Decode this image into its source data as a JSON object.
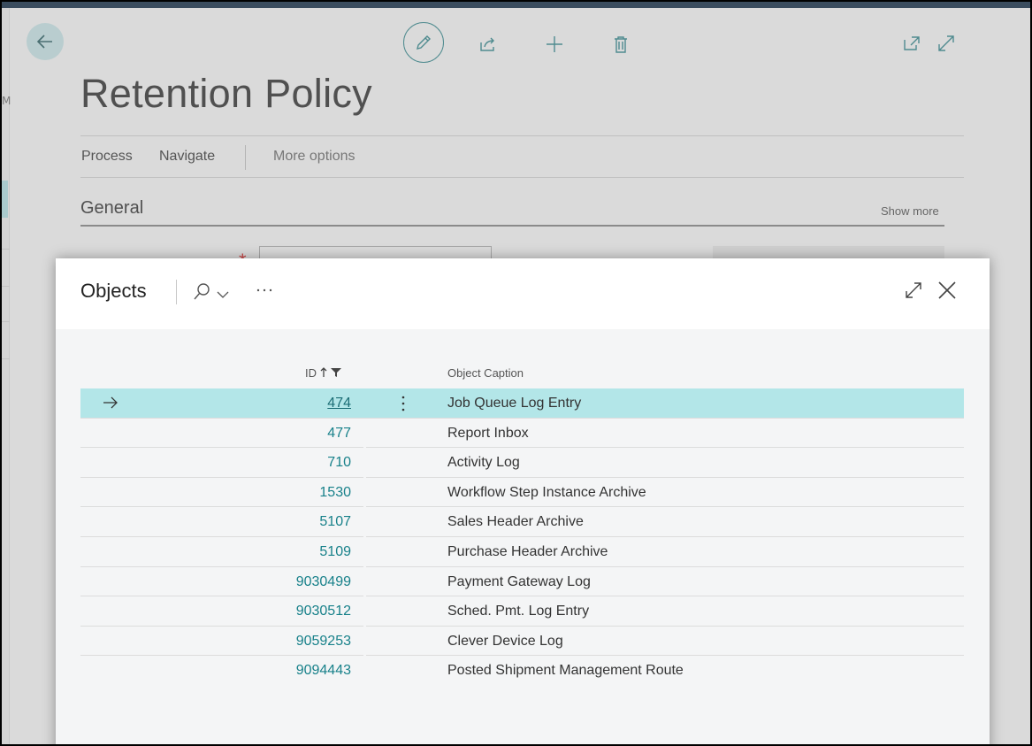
{
  "page": {
    "title": "Retention Policy",
    "menu": [
      "Process",
      "Navigate",
      "More options"
    ],
    "section": {
      "title": "General",
      "show_more": "Show more"
    }
  },
  "icons": {
    "back": "back-arrow-icon",
    "edit": "pencil-icon",
    "share": "share-icon",
    "new": "plus-icon",
    "delete": "trash-icon",
    "open_new_window": "open-in-new-window-icon",
    "expand": "expand-icon"
  },
  "dialog": {
    "title": "Objects",
    "columns": {
      "id": "ID",
      "caption": "Object Caption"
    },
    "rows": [
      {
        "id": "474",
        "caption": "Job Queue Log Entry"
      },
      {
        "id": "477",
        "caption": "Report Inbox"
      },
      {
        "id": "710",
        "caption": "Activity Log"
      },
      {
        "id": "1530",
        "caption": "Workflow Step Instance Archive"
      },
      {
        "id": "5107",
        "caption": "Sales Header Archive"
      },
      {
        "id": "5109",
        "caption": "Purchase Header Archive"
      },
      {
        "id": "9030499",
        "caption": "Payment Gateway Log"
      },
      {
        "id": "9030512",
        "caption": "Sched. Pmt. Log Entry"
      },
      {
        "id": "9059253",
        "caption": "Clever Device Log"
      },
      {
        "id": "9094443",
        "caption": "Posted Shipment Management Route"
      }
    ],
    "selected_index": 0
  },
  "colors": {
    "accent": "#18818a",
    "selected_row": "#b3e6e8",
    "required": "#c94a4a"
  }
}
